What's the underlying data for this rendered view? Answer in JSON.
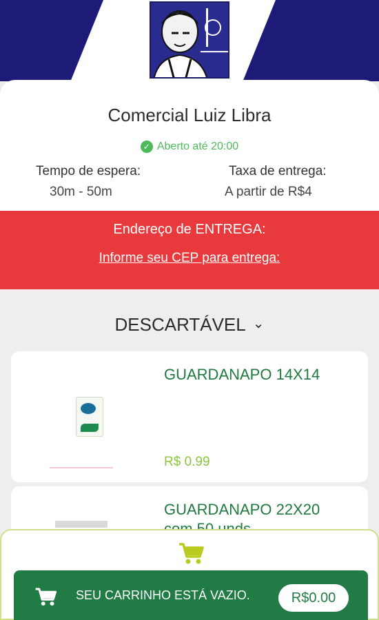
{
  "store": {
    "name": "Comercial Luiz Libra",
    "status": "Aberto até 20:00",
    "wait_label": "Tempo de espera:",
    "wait_value": "30m - 50m",
    "fee_label": "Taxa de entrega:",
    "fee_value": "A partir de R$4"
  },
  "address": {
    "title": "Endereço de ENTREGA:",
    "link": "Informe seu CEP para entrega:"
  },
  "category": {
    "label": "DESCARTÁVEL"
  },
  "products": [
    {
      "name": "GUARDANAPO 14X14",
      "price": "R$ 0.99"
    },
    {
      "name": "GUARDANAPO 22X20 com 50 unds"
    }
  ],
  "cart": {
    "text": "SEU CARRINHO ESTÁ VAZIO.",
    "total": "R$0.00"
  },
  "icons": {
    "status": "check-circle-icon",
    "category": "chevron-down-icon",
    "cart": "shopping-cart-icon"
  },
  "colors": {
    "banner": "#1d1a78",
    "status_green": "#4cba5a",
    "address_red": "#e83a3d",
    "product_name": "#1f7a3f",
    "price": "#8cc63f",
    "cart_bar": "#217b45"
  }
}
